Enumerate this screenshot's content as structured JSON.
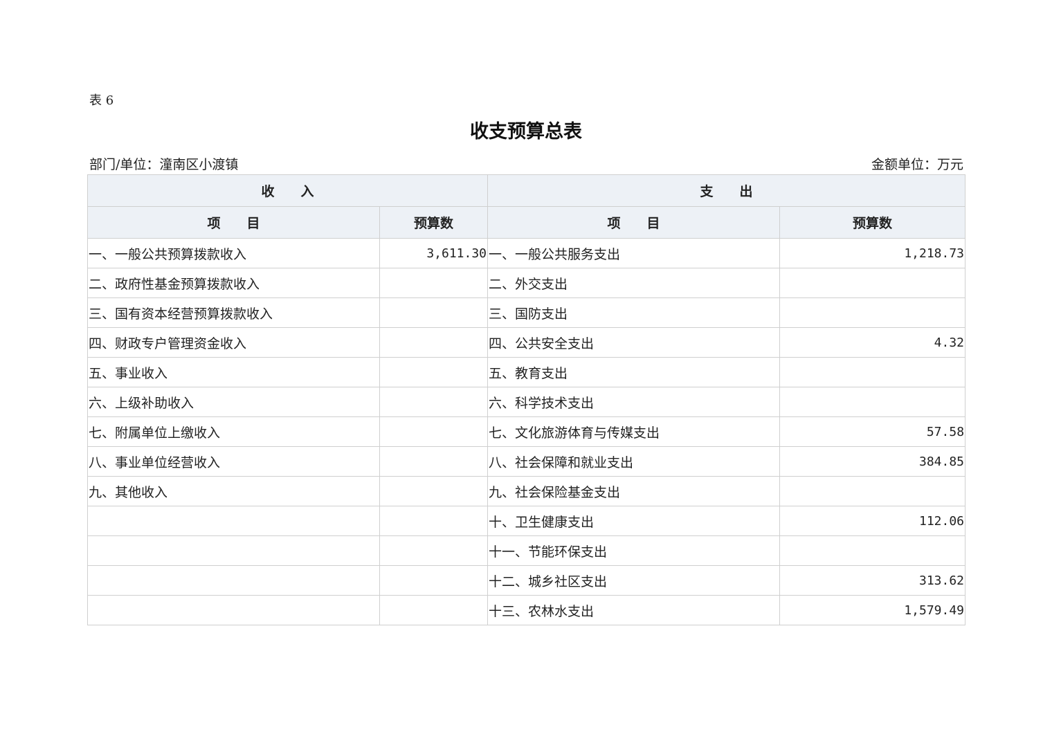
{
  "doc": {
    "table_label": "表 6",
    "title": "收支预算总表",
    "department": "部门/单位：潼南区小渡镇",
    "unit": "金额单位：万元"
  },
  "header": {
    "income": "收　　入",
    "expense": "支　　出",
    "item": "项　　目",
    "budget": "预算数"
  },
  "rows": [
    {
      "income_item": "一、一般公共预算拨款收入",
      "income_amount": "3,611.30",
      "expense_item": "一、一般公共服务支出",
      "expense_amount": "1,218.73"
    },
    {
      "income_item": "二、政府性基金预算拨款收入",
      "income_amount": "",
      "expense_item": "二、外交支出",
      "expense_amount": ""
    },
    {
      "income_item": "三、国有资本经营预算拨款收入",
      "income_amount": "",
      "expense_item": "三、国防支出",
      "expense_amount": ""
    },
    {
      "income_item": "四、财政专户管理资金收入",
      "income_amount": "",
      "expense_item": "四、公共安全支出",
      "expense_amount": "4.32"
    },
    {
      "income_item": "五、事业收入",
      "income_amount": "",
      "expense_item": "五、教育支出",
      "expense_amount": ""
    },
    {
      "income_item": "六、上级补助收入",
      "income_amount": "",
      "expense_item": "六、科学技术支出",
      "expense_amount": ""
    },
    {
      "income_item": "七、附属单位上缴收入",
      "income_amount": "",
      "expense_item": "七、文化旅游体育与传媒支出",
      "expense_amount": "57.58"
    },
    {
      "income_item": "八、事业单位经营收入",
      "income_amount": "",
      "expense_item": "八、社会保障和就业支出",
      "expense_amount": "384.85"
    },
    {
      "income_item": "九、其他收入",
      "income_amount": "",
      "expense_item": "九、社会保险基金支出",
      "expense_amount": ""
    },
    {
      "income_item": "",
      "income_amount": "",
      "expense_item": "十、卫生健康支出",
      "expense_amount": "112.06"
    },
    {
      "income_item": "",
      "income_amount": "",
      "expense_item": "十一、节能环保支出",
      "expense_amount": ""
    },
    {
      "income_item": "",
      "income_amount": "",
      "expense_item": "十二、城乡社区支出",
      "expense_amount": "313.62"
    },
    {
      "income_item": "",
      "income_amount": "",
      "expense_item": "十三、农林水支出",
      "expense_amount": "1,579.49"
    }
  ]
}
